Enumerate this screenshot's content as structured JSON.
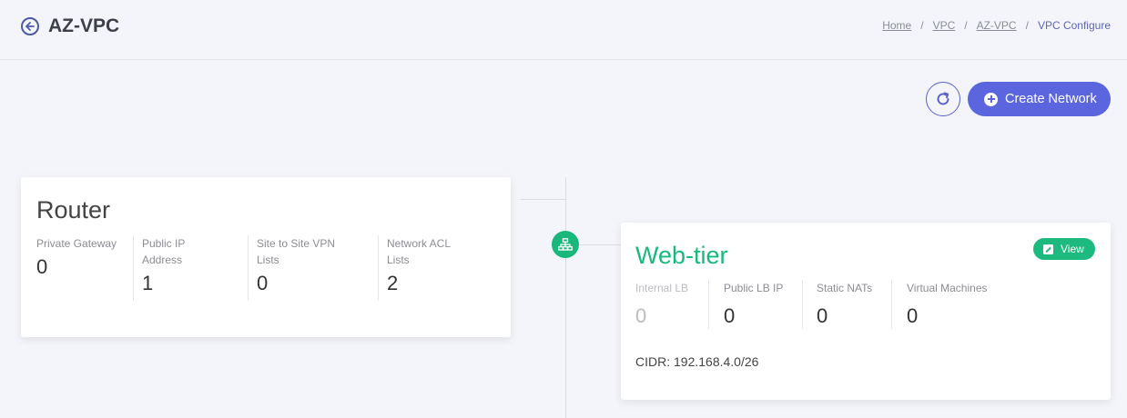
{
  "header": {
    "title": "AZ-VPC",
    "breadcrumb": [
      {
        "label": "Home"
      },
      {
        "label": "VPC"
      },
      {
        "label": "AZ-VPC"
      },
      {
        "label": "VPC Configure"
      }
    ],
    "breadcrumb_separator": "/"
  },
  "toolbar": {
    "create_label": "Create Network",
    "refresh_icon": "refresh-icon"
  },
  "router": {
    "title": "Router",
    "stats": [
      {
        "label": "Private Gateway",
        "value": "0"
      },
      {
        "label": "Public IP Address",
        "value": "1"
      },
      {
        "label": "Site to Site VPN Lists",
        "value": "0"
      },
      {
        "label": "Network ACL Lists",
        "value": "2"
      }
    ]
  },
  "tier": {
    "title": "Web-tier",
    "view_label": "View",
    "stats": [
      {
        "label": "Internal LB",
        "value": "0",
        "disabled": true
      },
      {
        "label": "Public LB IP",
        "value": "0"
      },
      {
        "label": "Static NATs",
        "value": "0"
      },
      {
        "label": "Virtual Machines",
        "value": "0"
      }
    ],
    "cidr": "CIDR: 192.168.4.0/26"
  },
  "colors": {
    "accent": "#5b66de",
    "success": "#19b87a",
    "background": "#f4f5fa"
  }
}
